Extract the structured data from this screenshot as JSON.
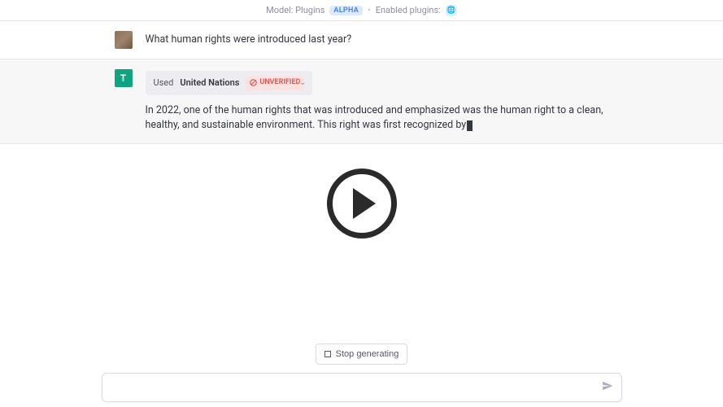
{
  "header": {
    "model_label": "Model: Plugins",
    "alpha": "ALPHA",
    "enabled_label": "Enabled plugins:",
    "plugin_glyph": "🌐"
  },
  "user": {
    "message": "What human rights were introduced last year?"
  },
  "assistant": {
    "avatar_letter": "T",
    "plugin_used_prefix": "Used",
    "plugin_name": "United Nations",
    "unverified_label": "UNVERIFIED",
    "response": "In 2022, one of the human rights that was introduced and emphasized was the human right to a clean, healthy, and sustainable environment. This right was first recognized by"
  },
  "controls": {
    "stop_label": "Stop generating",
    "input_placeholder": ""
  }
}
